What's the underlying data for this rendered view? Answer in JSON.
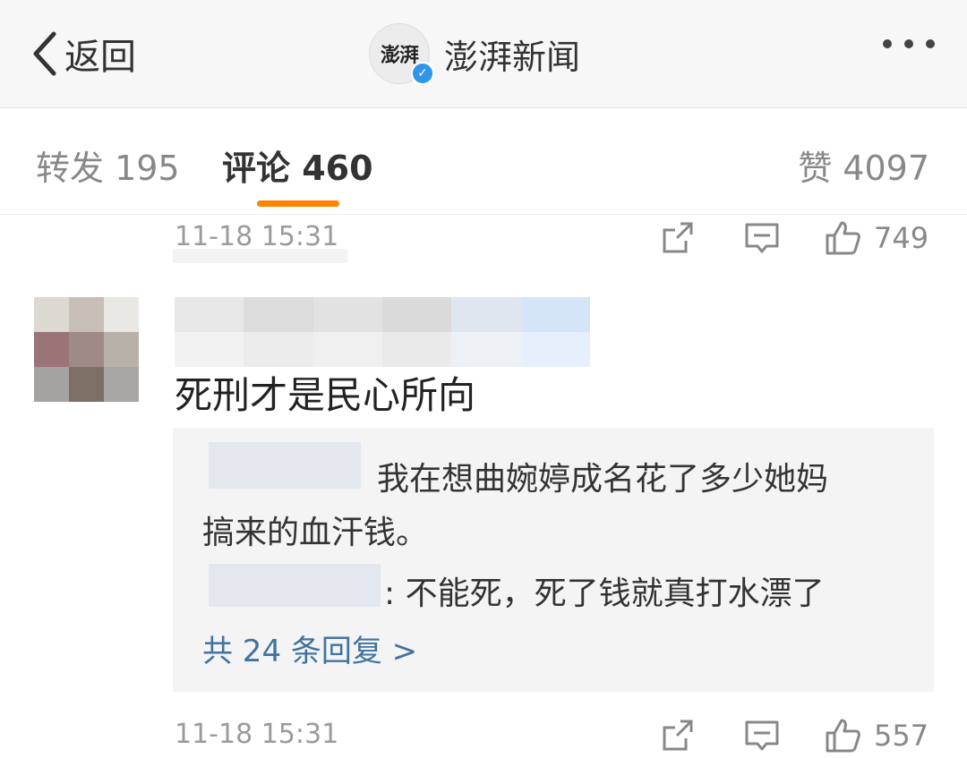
{
  "header": {
    "back_label": "返回",
    "avatar_text": "澎湃",
    "account_name": "澎湃新闻"
  },
  "tabs": {
    "repost": "转发 195",
    "comment": "评论 460",
    "like": "赞 4097"
  },
  "comments": [
    {
      "time": "11-18 15:31",
      "likes": "749"
    },
    {
      "text": "死刑才是民心所向",
      "replies": [
        {
          "line1": "我在想曲婉婷成名花了多少她妈",
          "line2": "搞来的血汗钱。"
        },
        {
          "line1": ": 不能死，死了钱就真打水漂了"
        }
      ],
      "more_replies": "共 24 条回复 >",
      "time": "11-18 15:31",
      "likes": "557"
    }
  ],
  "colors": {
    "accent": "#ff8200",
    "link": "#41739f",
    "verified": "#2e95e8"
  }
}
